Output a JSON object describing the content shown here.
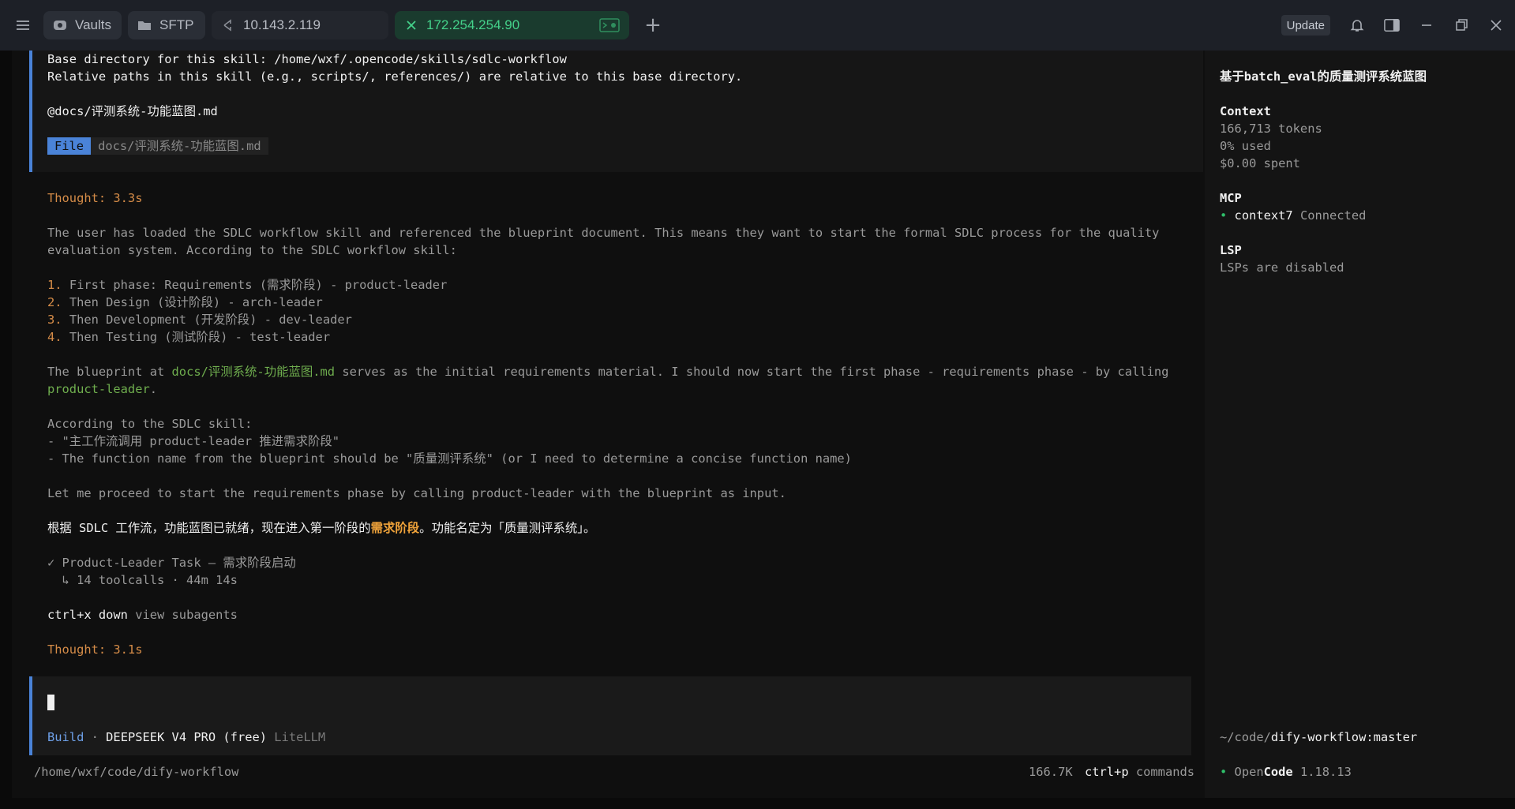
{
  "topbar": {
    "tabs": [
      {
        "label": "Vaults",
        "icon": "vault-icon"
      },
      {
        "label": "SFTP",
        "icon": "folder-icon"
      },
      {
        "label": "10.143.2.119",
        "icon": "host-icon"
      },
      {
        "label": "172.254.254.90",
        "icon": "close-icon",
        "active": true
      }
    ],
    "update_label": "Update"
  },
  "user_message": {
    "line1": "Base directory for this skill: /home/wxf/.opencode/skills/sdlc-workflow",
    "line2": "Relative paths in this skill (e.g., scripts/, references/) are relative to this base directory.",
    "line3": "@docs/评测系统-功能蓝图.md",
    "file_tag": "File",
    "file_path": "docs/评测系统-功能蓝图.md"
  },
  "assistant": {
    "thought1": "Thought: 3.3s",
    "p1_line1": "The user has loaded the SDLC workflow skill and referenced the blueprint document. This means they want to start the formal SDLC process for the quality",
    "p1_line2": "evaluation system. According to the SDLC workflow skill:",
    "list": [
      {
        "num": "1.",
        "text": " First phase: Requirements (需求阶段) - product-leader"
      },
      {
        "num": "2.",
        "text": " Then Design (设计阶段) - arch-leader"
      },
      {
        "num": "3.",
        "text": " Then Development (开发阶段) - dev-leader"
      },
      {
        "num": "4.",
        "text": " Then Testing (测试阶段) - test-leader"
      }
    ],
    "p2_a": "The blueprint at ",
    "p2_link": "docs/评测系统-功能蓝图.md",
    "p2_b": " serves as the initial requirements material. I should now start the first phase - requirements phase - by calling",
    "p2_link2": "product-leader",
    "p2_end": ".",
    "p3_line1": "According to the SDLC skill:",
    "p3_line2": "- \"主工作流调用 product-leader 推进需求阶段\"",
    "p3_line3": "- The function name from the blueprint should be \"质量测评系统\" (or I need to determine a concise function name)",
    "p4": "Let me proceed to start the requirements phase by calling product-leader with the blueprint as input.",
    "reply_a": "根据 SDLC 工作流，功能蓝图已就绪，现在进入第一阶段的",
    "reply_hl": "需求阶段",
    "reply_b": "。功能名定为「质量测评系统」。",
    "task_line": "✓ Product-Leader Task — 需求阶段启动",
    "task_sub": "  ↳ 14 toolcalls · 44m 14s",
    "key_hint": "ctrl+x down",
    "key_hint_desc": " view subagents",
    "thought2": "Thought: 3.1s"
  },
  "input": {
    "mode": "Build",
    "sep": " · ",
    "model": "DEEPSEEK V4 PRO (free)",
    "provider": " LiteLLM"
  },
  "status": {
    "cwd": "/home/wxf/code/dify-workflow",
    "tokens": "166.7K",
    "cmd_key": "ctrl+p",
    "cmd_label": " commands"
  },
  "sidebar": {
    "title": "基于batch_eval的质量测评系统蓝图",
    "context_heading": "Context",
    "tokens": "166,713 tokens",
    "used": "0% used",
    "spent": "$0.00 spent",
    "mcp_heading": "MCP",
    "mcp_name": "context7",
    "mcp_status": " Connected",
    "lsp_heading": "LSP",
    "lsp_status": "LSPs are disabled",
    "path_prefix": "~/code/",
    "path_repo": "dify-workflow:master",
    "app_open": "Open",
    "app_code": "Code",
    "app_version": " 1.18.13"
  },
  "colors": {
    "accent": "#4a83d8",
    "active_tab": "#44d18a",
    "thought": "#d58c48",
    "link": "#6fae4e",
    "status_dot": "#2fbf6a"
  }
}
